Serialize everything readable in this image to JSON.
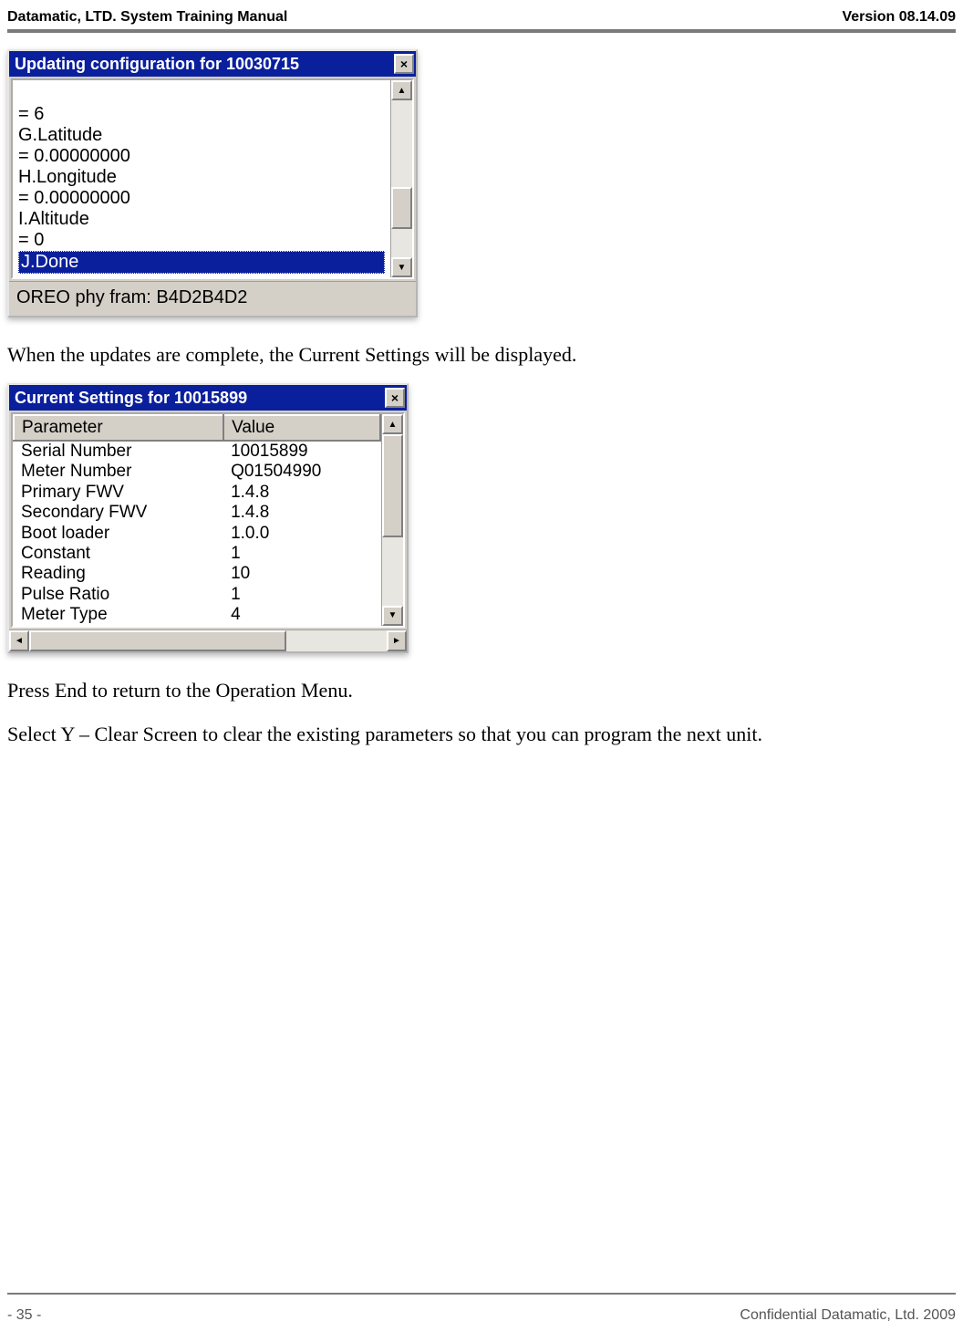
{
  "header": {
    "left": "Datamatic, LTD. System Training  Manual",
    "right": "Version 08.14.09"
  },
  "window1": {
    "title": "Updating configuration for 10030715",
    "close": "×",
    "lines": [
      "= 6",
      "G.Latitude",
      "= 0.00000000",
      "H.Longitude",
      "= 0.00000000",
      "I.Altitude",
      "= 0"
    ],
    "selected": "J.Done",
    "status": "OREO phy fram: B4D2B4D2",
    "scroll_up": "▲",
    "scroll_down": "▼"
  },
  "paragraph1": "When the updates are complete, the Current Settings will be displayed.",
  "window2": {
    "title": "Current Settings for 10015899",
    "close": "×",
    "col1": "Parameter",
    "col2": "Value",
    "rows": [
      {
        "p": "Serial Number",
        "v": "10015899"
      },
      {
        "p": "Meter Number",
        "v": "Q01504990"
      },
      {
        "p": "Primary FWV",
        "v": "1.4.8"
      },
      {
        "p": "Secondary FWV",
        "v": "1.4.8"
      },
      {
        "p": "Boot loader",
        "v": "1.0.0"
      },
      {
        "p": "Constant",
        "v": "1"
      },
      {
        "p": "Reading",
        "v": "10"
      },
      {
        "p": "Pulse Ratio",
        "v": "1"
      },
      {
        "p": "Meter Type",
        "v": "4"
      }
    ],
    "scroll_up": "▲",
    "scroll_down": "▼",
    "scroll_left": "◄",
    "scroll_right": "►"
  },
  "paragraph2": "Press End to return to the Operation Menu.",
  "paragraph3": "Select Y – Clear Screen to clear the existing parameters so that you can program the next unit.",
  "footer": {
    "left": "- 35 -",
    "right": "Confidential Datamatic, Ltd. 2009"
  }
}
